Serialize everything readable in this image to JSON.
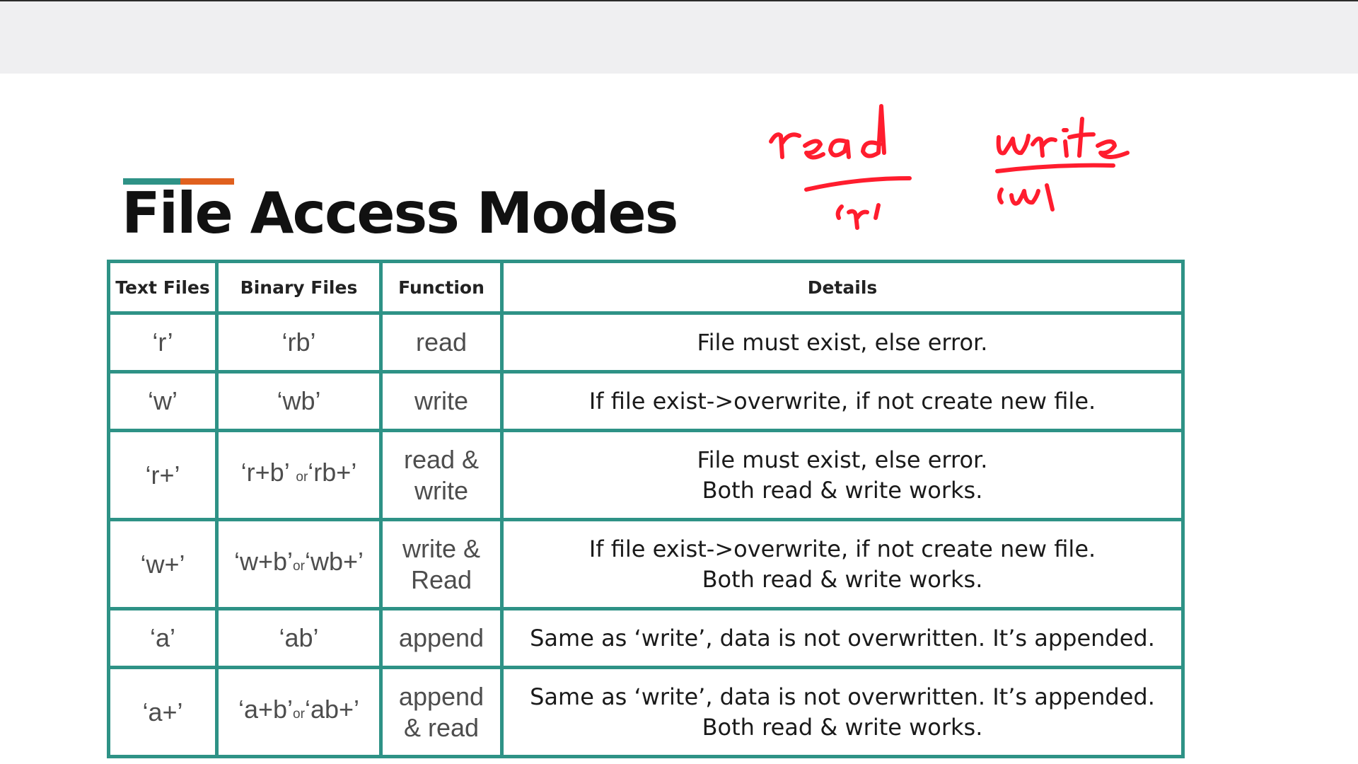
{
  "page_title": "File Access Modes",
  "colors": {
    "accent_teal": "#2e9286",
    "accent_orange": "#e0601e",
    "ink_red": "#ff1d2e"
  },
  "annotations": {
    "read_word": "read",
    "read_code": "'r'",
    "write_word": "write",
    "write_code": "'w'"
  },
  "table": {
    "headers": [
      "Text Files",
      "Binary Files",
      "Function",
      "Details"
    ],
    "rows": [
      {
        "text": "‘r’",
        "binary": [
          "‘rb’"
        ],
        "function": [
          "read"
        ],
        "details": [
          "File must exist, else error."
        ]
      },
      {
        "text": "‘w’",
        "binary": [
          "‘wb’"
        ],
        "function": [
          "write"
        ],
        "details": [
          "If file exist->overwrite, if not create new file."
        ]
      },
      {
        "text": "‘r+’",
        "binary": [
          "‘r+b’",
          "or",
          "‘rb+’"
        ],
        "function": [
          "read &",
          "write"
        ],
        "details": [
          "File must exist, else error.",
          "Both read & write works."
        ]
      },
      {
        "text": "‘w+’",
        "binary": [
          "‘w+b’",
          "or",
          "‘wb+’"
        ],
        "function": [
          "write &",
          "Read"
        ],
        "details": [
          "If file exist->overwrite, if not create new file.",
          "Both read & write works."
        ]
      },
      {
        "text": "‘a’",
        "binary": [
          "‘ab’"
        ],
        "function": [
          "append"
        ],
        "details": [
          "Same as ‘write’, data is not overwritten. It’s appended."
        ]
      },
      {
        "text": "‘a+’",
        "binary": [
          "‘a+b’",
          "or",
          "‘ab+’"
        ],
        "function": [
          "append",
          "& read"
        ],
        "details": [
          "Same as ‘write’, data is not overwritten. It’s appended.",
          "Both read & write works."
        ]
      }
    ]
  }
}
